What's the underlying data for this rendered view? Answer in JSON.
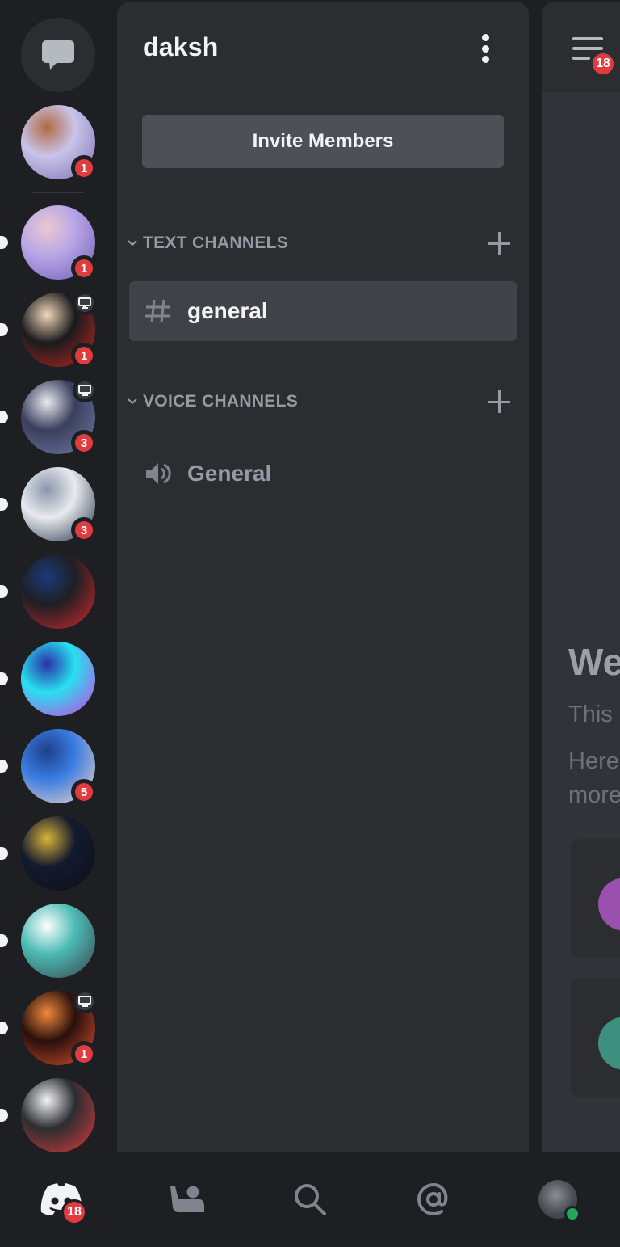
{
  "rail": {
    "dm_button": {
      "icon": "chat-bubble-icon"
    },
    "guilds": [
      {
        "name": "ultra-instinct-server",
        "badge": "1",
        "live": false,
        "unread_pill": false,
        "colors": [
          "#c9c4ea",
          "#7a6fb0",
          "#b06a43"
        ]
      },
      {
        "name": "anime-girl-purple-server",
        "badge": "1",
        "live": false,
        "unread_pill": true,
        "colors": [
          "#b9a6e6",
          "#6d5bb8",
          "#e9c9d1"
        ]
      },
      {
        "name": "santa-hat-server",
        "badge": "1",
        "live": true,
        "unread_pill": true,
        "colors": [
          "#1a1a1e",
          "#c8281f",
          "#f2d7b8"
        ]
      },
      {
        "name": "winter-village-server",
        "badge": "3",
        "live": true,
        "unread_pill": true,
        "colors": [
          "#3a3f5c",
          "#6f7aa8",
          "#e8e9f0"
        ]
      },
      {
        "name": "bridge-logo-server",
        "badge": "3",
        "live": false,
        "unread_pill": true,
        "colors": [
          "#e8eaee",
          "#1d2b45",
          "#8a96aa"
        ]
      },
      {
        "name": "fantasy-football-chat",
        "badge": "",
        "live": false,
        "unread_pill": true,
        "colors": [
          "#1e1f22",
          "#d6282f",
          "#1a3b7a"
        ]
      },
      {
        "name": "fluid-art-server",
        "badge": "",
        "live": false,
        "unread_pill": true,
        "colors": [
          "#27e0f0",
          "#d43ae0",
          "#2a2fa8"
        ]
      },
      {
        "name": "blue-hair-anime-server",
        "badge": "5",
        "live": false,
        "unread_pill": true,
        "colors": [
          "#3a7ce0",
          "#f5d8c8",
          "#1d3f8a"
        ]
      },
      {
        "name": "marvel-studios-server",
        "badge": "",
        "live": false,
        "unread_pill": true,
        "colors": [
          "#141a2e",
          "#0b0e1a",
          "#d9b43a"
        ]
      },
      {
        "name": "clapperboard-server",
        "badge": "",
        "live": false,
        "unread_pill": true,
        "colors": [
          "#4cbcb4",
          "#3a3c4a",
          "#ffffff"
        ]
      },
      {
        "name": "network-graduation-server",
        "badge": "1",
        "live": true,
        "unread_pill": true,
        "colors": [
          "#2a0f0c",
          "#e0542e",
          "#f08a3c"
        ]
      },
      {
        "name": "tcc-car-server",
        "badge": "",
        "live": false,
        "unread_pill": true,
        "colors": [
          "#2b2d31",
          "#e23b3b",
          "#f2f3f5"
        ]
      }
    ]
  },
  "panel": {
    "server_name": "daksh",
    "invite_label": "Invite Members",
    "categories": [
      {
        "label": "TEXT CHANNELS",
        "channels": [
          {
            "type": "text",
            "name": "general",
            "active": true
          }
        ]
      },
      {
        "label": "VOICE CHANNELS",
        "channels": [
          {
            "type": "voice",
            "name": "General",
            "active": false
          }
        ]
      }
    ]
  },
  "chat": {
    "menu_badge": "18",
    "welcome_fragment": "We",
    "line1_fragment": "This",
    "line2_fragment": "Here",
    "line3_fragment": "more",
    "cards": [
      {
        "color": "#9b4fae"
      },
      {
        "color": "#3f8f7f"
      }
    ]
  },
  "nav": {
    "items": [
      {
        "name": "home",
        "icon": "discord-logo-icon",
        "badge": "18",
        "active": true
      },
      {
        "name": "friends",
        "icon": "friends-wave-icon",
        "badge": "",
        "active": false
      },
      {
        "name": "search",
        "icon": "search-icon",
        "badge": "",
        "active": false
      },
      {
        "name": "mentions",
        "icon": "at-sign-icon",
        "badge": "",
        "active": false
      },
      {
        "name": "profile",
        "icon": "user-avatar",
        "badge": "",
        "active": false,
        "status": "online"
      }
    ]
  },
  "colors": {
    "badge_red": "#e03b3f",
    "online_green": "#23a55a",
    "rail_bg": "#1e1f22",
    "panel_bg": "#2b2d31",
    "chat_bg": "#313338",
    "active_channel": "#404249",
    "invite_button": "#4e5058"
  }
}
